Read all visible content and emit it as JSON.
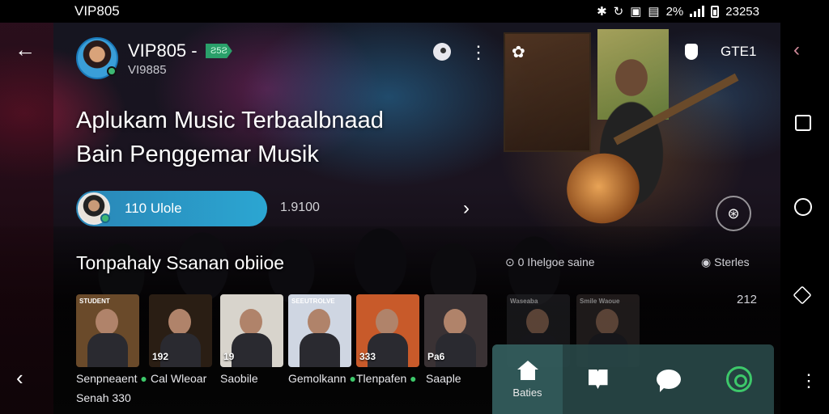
{
  "status_bar": {
    "carrier": "VIP805",
    "battery_percent": "2%",
    "clock": "23253"
  },
  "header": {
    "user_name": "VIP805 -",
    "badge": "Ƨ5Ƨ",
    "user_handle": "VI9885",
    "right_label": "GTE1"
  },
  "hero": {
    "line1": "Aplukam Music Terbaalbnaad",
    "line2": "Bain Penggemar Musik",
    "pill_label": "110 Ulole",
    "pill_count": "1.9100"
  },
  "section": {
    "title": "Tonpahaly Ssanan obiioe",
    "meta": "0 Ihelgoe saine",
    "link": "Sterles",
    "side_count": "212"
  },
  "cards": [
    {
      "tag": "STUDENT",
      "num": "",
      "label": "Senpneaent",
      "check": true,
      "bg": "#6a4a2a"
    },
    {
      "tag": "",
      "num": "192",
      "label": "Cal Wleoar",
      "check": false,
      "bg": "#2a1e14"
    },
    {
      "tag": "",
      "num": "19",
      "label": "Saobile",
      "check": false,
      "bg": "#d8d4cc"
    },
    {
      "tag": "SEEUTROLVE",
      "num": "",
      "label": "Gemolkann",
      "check": true,
      "bg": "#cfd6e2"
    },
    {
      "tag": "",
      "num": "333",
      "label": "Tlenpafen",
      "check": true,
      "bg": "#c85a2a"
    },
    {
      "tag": "",
      "num": "Pa6",
      "label": "Saaple",
      "check": false,
      "bg": "#3a3234"
    },
    {
      "tag": "Waseaba",
      "num": "",
      "label": "",
      "check": false,
      "bg": "#2a2a2e"
    },
    {
      "tag": "Smile Waoue",
      "num": "",
      "label": "",
      "check": false,
      "bg": "#3a3230"
    }
  ],
  "card_sub": "Senah 330",
  "tabbar": {
    "tabs": [
      {
        "icon": "home-icon",
        "label": "Baties",
        "active": true
      },
      {
        "icon": "book-icon",
        "label": "",
        "active": false
      },
      {
        "icon": "chat-icon",
        "label": "",
        "active": false
      },
      {
        "icon": "search-icon",
        "label": "",
        "active": false
      }
    ]
  },
  "colors": {
    "accent_green": "#3dc86a",
    "pill_blue": "#2a86b6",
    "tabbar_bg": "#284646"
  }
}
